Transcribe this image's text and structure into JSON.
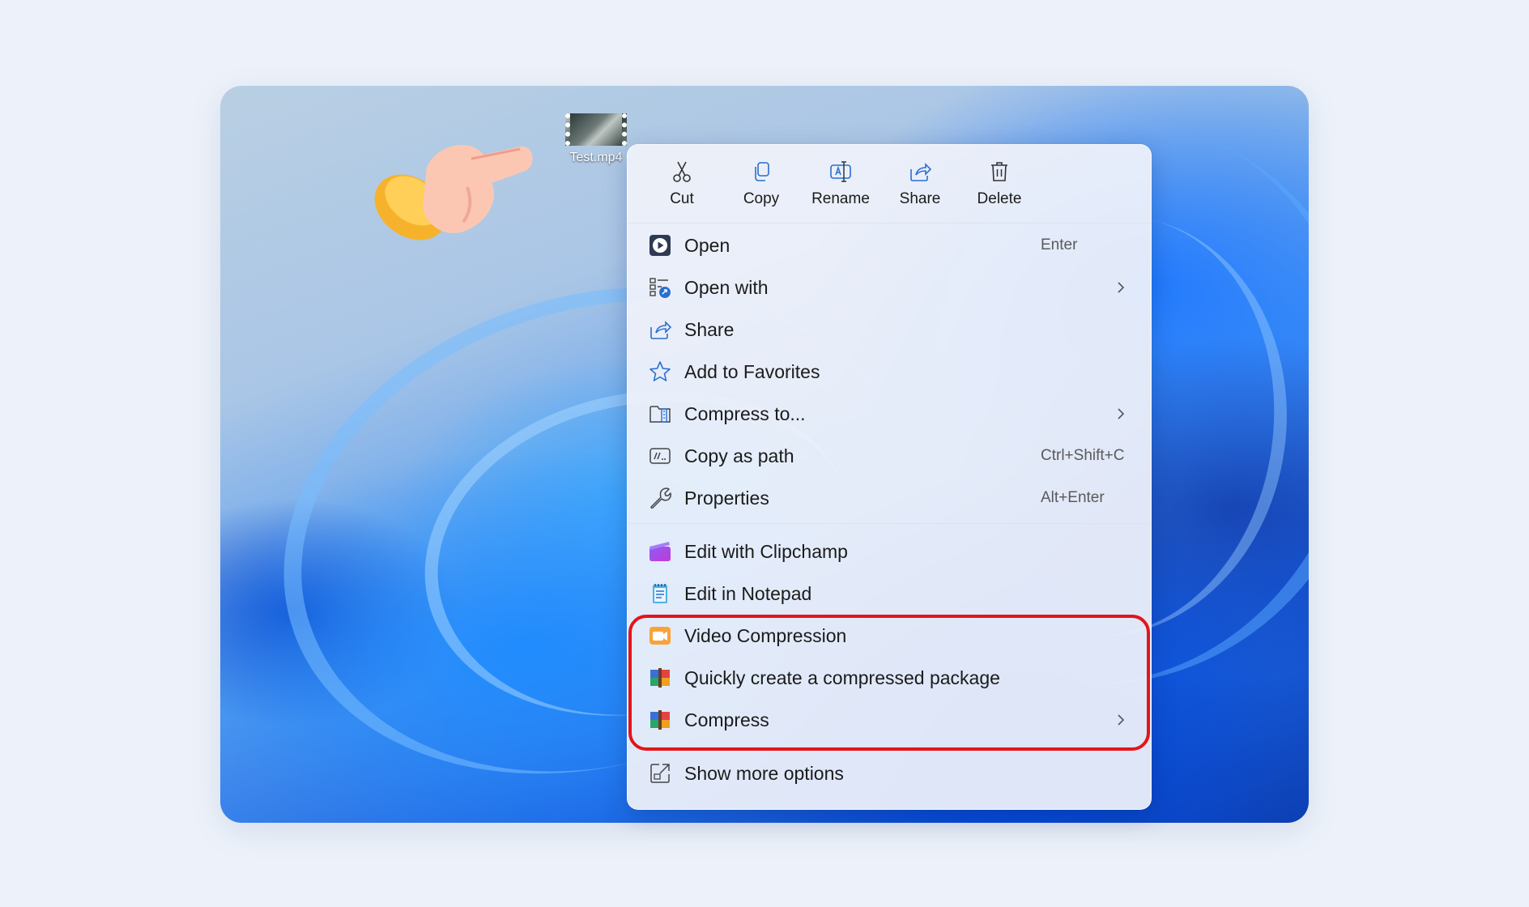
{
  "desktop": {
    "file_name": "Test.mp4"
  },
  "menu": {
    "toolbar": [
      {
        "label": "Cut",
        "icon": "cut-icon"
      },
      {
        "label": "Copy",
        "icon": "copy-icon"
      },
      {
        "label": "Rename",
        "icon": "rename-icon"
      },
      {
        "label": "Share",
        "icon": "share-icon"
      },
      {
        "label": "Delete",
        "icon": "delete-icon"
      }
    ],
    "items": [
      {
        "label": "Open",
        "shortcut": "Enter",
        "icon": "open-media-icon"
      },
      {
        "label": "Open with",
        "shortcut": "",
        "icon": "open-with-icon",
        "submenu": true
      },
      {
        "label": "Share",
        "shortcut": "",
        "icon": "share-icon"
      },
      {
        "label": "Add to Favorites",
        "shortcut": "",
        "icon": "star-icon"
      },
      {
        "label": "Compress to...",
        "shortcut": "",
        "icon": "compress-icon",
        "submenu": true
      },
      {
        "label": "Copy as path",
        "shortcut": "Ctrl+Shift+C",
        "icon": "copy-path-icon"
      },
      {
        "label": "Properties",
        "shortcut": "Alt+Enter",
        "icon": "wrench-icon"
      },
      {
        "label": "Edit with Clipchamp",
        "shortcut": "",
        "icon": "clipchamp-icon"
      },
      {
        "label": "Edit in Notepad",
        "shortcut": "",
        "icon": "notepad-icon"
      },
      {
        "label": "Video Compression",
        "shortcut": "",
        "icon": "video-compression-icon"
      },
      {
        "label": "Quickly create a compressed package",
        "shortcut": "",
        "icon": "archive-icon"
      },
      {
        "label": "Compress",
        "shortcut": "",
        "icon": "archive-icon",
        "submenu": true
      },
      {
        "label": "Show more options",
        "shortcut": "",
        "icon": "more-options-icon"
      }
    ]
  },
  "colors": {
    "highlight": "#e3151b",
    "menu_bg": "#f0f2fa",
    "accent": "#1f6fd6"
  }
}
